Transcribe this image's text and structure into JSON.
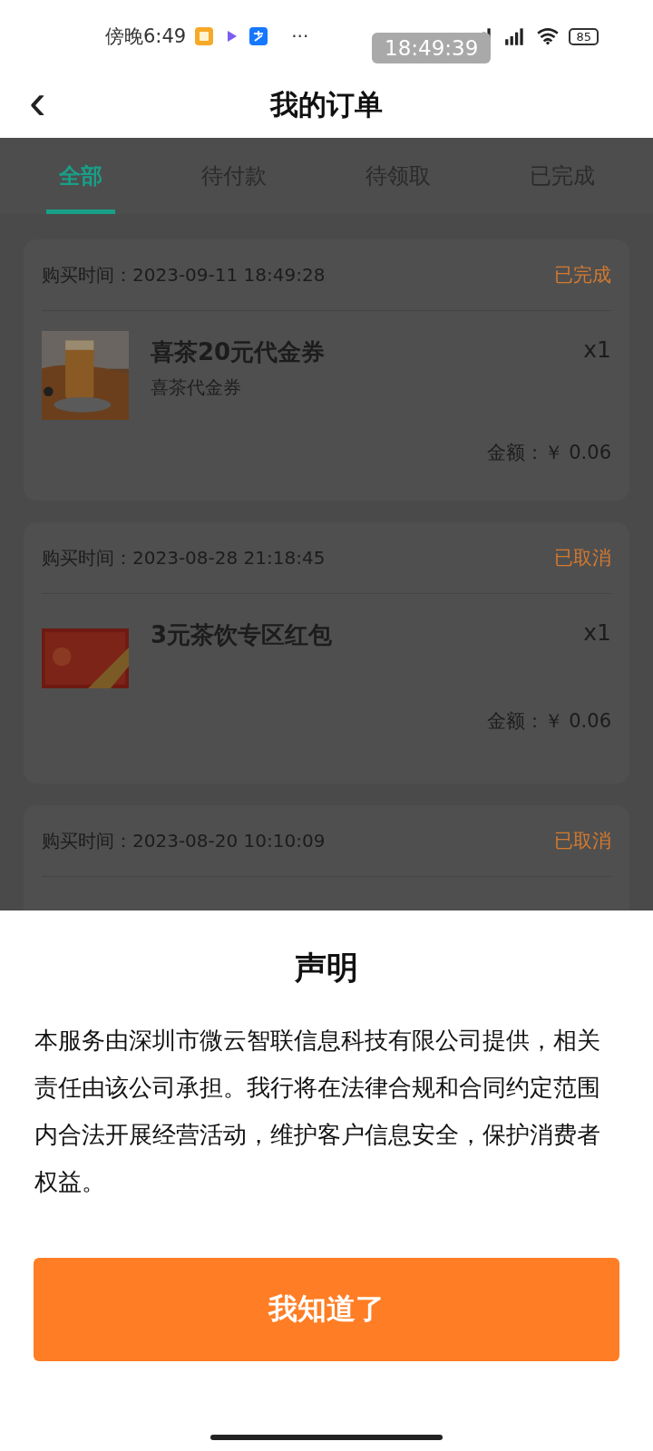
{
  "status_bar": {
    "time": "傍晚6:49",
    "more": "···",
    "battery": "85",
    "clock_overlay": "18:49:39"
  },
  "header": {
    "back": "‹",
    "title": "我的订单"
  },
  "tabs": [
    {
      "label": "全部",
      "selected": true
    },
    {
      "label": "待付款",
      "selected": false
    },
    {
      "label": "待领取",
      "selected": false
    },
    {
      "label": "已完成",
      "selected": false
    }
  ],
  "orders": [
    {
      "time": "购买时间：2023-09-11 18:49:28",
      "status": "已完成",
      "title": "喜茶20元代金券",
      "subtitle": "喜茶代金券",
      "qty": "x1",
      "amount": "金额：￥ 0.06"
    },
    {
      "time": "购买时间：2023-08-28 21:18:45",
      "status": "已取消",
      "kind": "coupon",
      "title": "3元茶饮专区红包",
      "qty": "x1",
      "amount": "金额：￥ 0.06"
    },
    {
      "time": "购买时间：2023-08-20 10:10:09",
      "status": "已取消"
    }
  ],
  "dialog": {
    "title": "声明",
    "body": "本服务由深圳市微云智联信息科技有限公司提供，相关责任由该公司承担。我行将在法律合规和合同约定范围内合法开展经营活动，维护客户信息安全，保护消费者权益。",
    "button": "我知道了"
  }
}
